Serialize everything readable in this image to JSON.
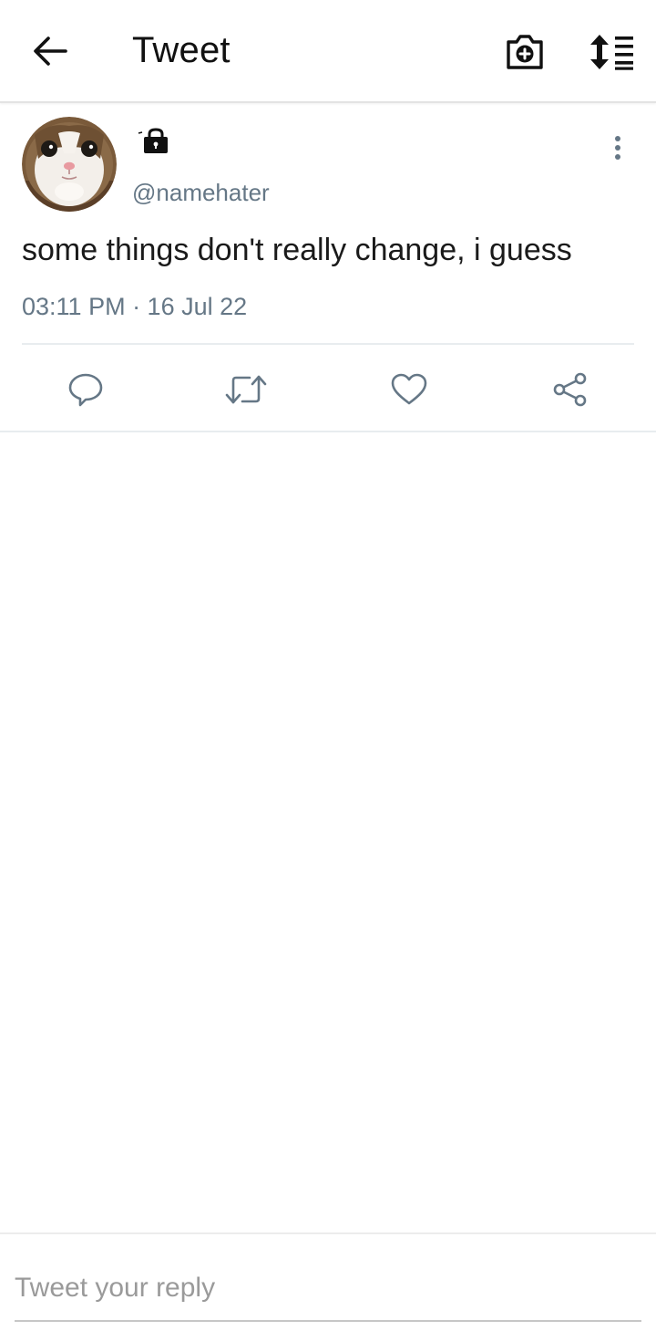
{
  "appbar": {
    "title": "Tweet",
    "back_icon": "arrow-left-icon",
    "camera_icon": "camera-plus-icon",
    "sort_icon": "sort-list-icon"
  },
  "tweet": {
    "display_name": "",
    "locked_icon": "lock-icon",
    "handle": "@namehater",
    "text": "some things don't really change, i guess",
    "timestamp": "03:11 PM · 16 Jul 22",
    "avatar": "cat-avatar",
    "more_icon": "more-vertical-icon"
  },
  "actions": {
    "reply_icon": "comment-icon",
    "retweet_icon": "retweet-icon",
    "like_icon": "heart-icon",
    "share_icon": "share-icon"
  },
  "reply": {
    "placeholder": "Tweet your reply"
  },
  "colors": {
    "text_primary": "#1a1a1a",
    "text_secondary": "#657786",
    "divider": "#e8ecef",
    "icon_gray": "#657786"
  }
}
